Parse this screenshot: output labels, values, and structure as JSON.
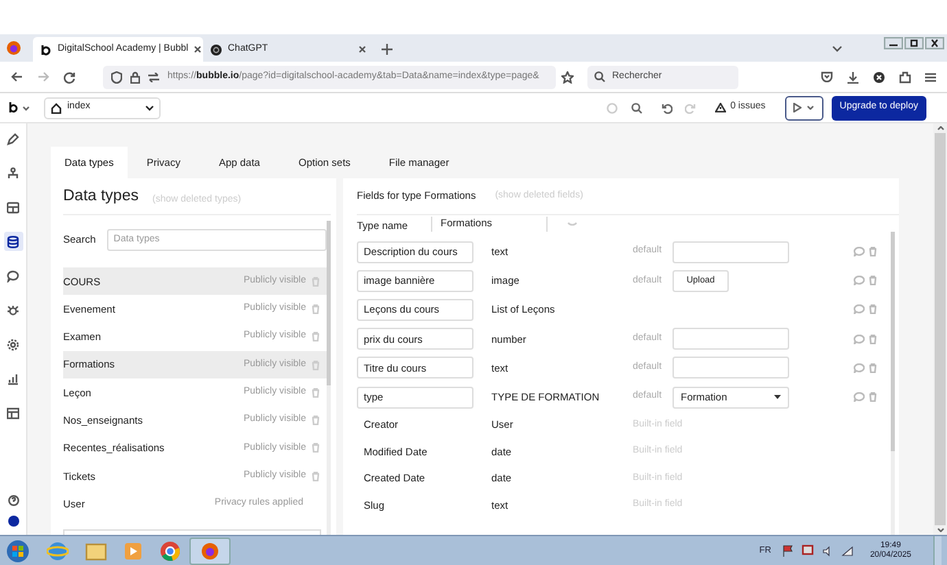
{
  "browser": {
    "tabs": [
      {
        "title": "DigitalSchool Academy | Bubbl",
        "kind": "bubble",
        "selected": true
      },
      {
        "title": "ChatGPT",
        "kind": "chatgpt",
        "selected": false
      }
    ],
    "url_host": "bubble.io",
    "url_rest": "/page?id=digitalschool-academy&tab=Data&name=index&type=page&",
    "url_scheme": "https://",
    "search_placeholder": "Rechercher"
  },
  "editor": {
    "page": "index",
    "issues": "0 issues",
    "deploy": "Upgrade to deploy"
  },
  "sidebar": [
    {
      "kind": "pencil",
      "selected": false
    },
    {
      "kind": "tree",
      "selected": false
    },
    {
      "kind": "layout",
      "selected": false
    },
    {
      "kind": "database",
      "selected": true
    },
    {
      "kind": "chat",
      "selected": false
    },
    {
      "kind": "bug",
      "selected": false
    },
    {
      "kind": "gear",
      "selected": false
    },
    {
      "kind": "chart",
      "selected": false
    },
    {
      "kind": "table",
      "selected": false
    }
  ],
  "tabs": [
    {
      "label": "Data types",
      "selected": true
    },
    {
      "label": "Privacy",
      "selected": false
    },
    {
      "label": "App data",
      "selected": false
    },
    {
      "label": "Option sets",
      "selected": false
    },
    {
      "label": "File manager",
      "selected": false
    }
  ],
  "data_types": {
    "title": "Data types",
    "show_deleted": "(show deleted types)",
    "search_label": "Search",
    "search_placeholder": "Data types",
    "items": [
      {
        "name": "COURS",
        "visibility": "Publicly visible",
        "deletable": true,
        "highlighted": true
      },
      {
        "name": "Evenement",
        "visibility": "Publicly visible",
        "deletable": true,
        "highlighted": false
      },
      {
        "name": "Examen",
        "visibility": "Publicly visible",
        "deletable": true,
        "highlighted": false
      },
      {
        "name": "Formations",
        "visibility": "Publicly visible",
        "deletable": true,
        "highlighted": true
      },
      {
        "name": "Leçon",
        "visibility": "Publicly visible",
        "deletable": true,
        "highlighted": false
      },
      {
        "name": "Nos_enseignants",
        "visibility": "Publicly visible",
        "deletable": true,
        "highlighted": false
      },
      {
        "name": "Recentes_réalisations",
        "visibility": "Publicly visible",
        "deletable": true,
        "highlighted": false
      },
      {
        "name": "Tickets",
        "visibility": "Publicly visible",
        "deletable": true,
        "highlighted": false
      },
      {
        "name": "User",
        "visibility": "Privacy rules applied",
        "deletable": false,
        "highlighted": false
      }
    ]
  },
  "fields": {
    "title": "Fields for type Formations",
    "show_deleted": "(show deleted fields)",
    "type_name_label": "Type name",
    "type_name": "Formations",
    "rows": [
      {
        "kind": "custom",
        "name": "Description du cours",
        "type": "text",
        "default": {
          "kind": "input",
          "label": "default"
        }
      },
      {
        "kind": "custom",
        "name": "image bannière",
        "type": "image",
        "default": {
          "kind": "upload",
          "label": "default",
          "value": "Upload"
        }
      },
      {
        "kind": "custom",
        "name": "Leçons du cours",
        "type": "List of Leçons"
      },
      {
        "kind": "custom",
        "name": "prix du cours",
        "type": "number",
        "default": {
          "kind": "input",
          "label": "default"
        }
      },
      {
        "kind": "custom",
        "name": "Titre du cours",
        "type": "text",
        "default": {
          "kind": "input",
          "label": "default"
        }
      },
      {
        "kind": "custom",
        "name": "type",
        "type": "TYPE DE FORMATION",
        "default": {
          "kind": "select",
          "label": "default",
          "value": "Formation"
        }
      },
      {
        "kind": "builtin",
        "name": "Creator",
        "type": "User",
        "note": "Built-in field"
      },
      {
        "kind": "builtin",
        "name": "Modified Date",
        "type": "date",
        "note": "Built-in field"
      },
      {
        "kind": "builtin",
        "name": "Created Date",
        "type": "date",
        "note": "Built-in field"
      },
      {
        "kind": "builtin",
        "name": "Slug",
        "type": "text",
        "note": "Built-in field"
      }
    ]
  },
  "taskbar": {
    "language": "FR",
    "time": "19:49",
    "date": "20/04/2025"
  }
}
